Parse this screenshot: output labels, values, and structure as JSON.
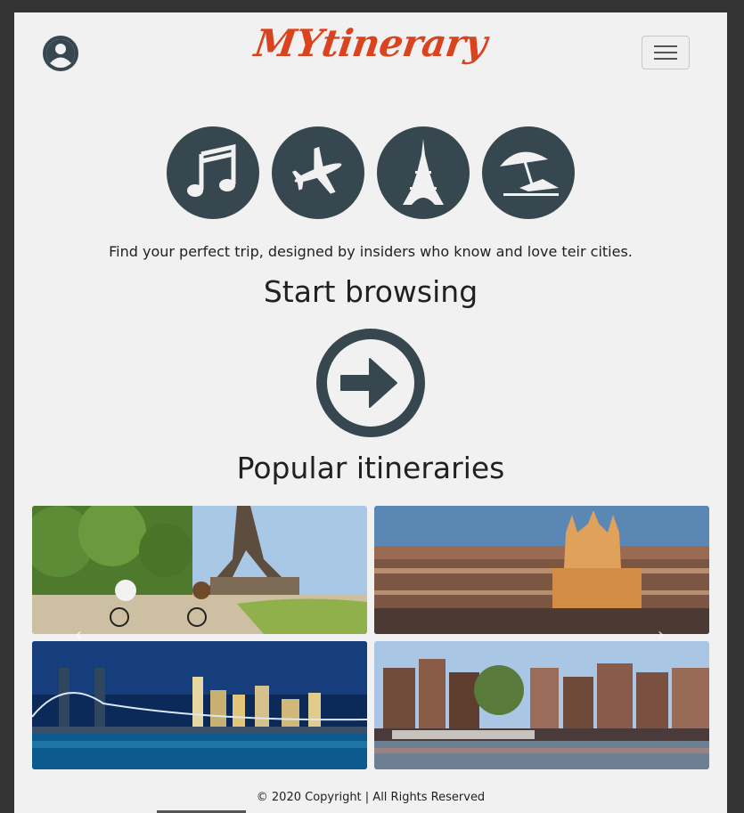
{
  "header": {
    "logo_text": "MYtinerary",
    "user_icon": "user-circle-icon",
    "menu_icon": "hamburger-icon"
  },
  "hero": {
    "icons": [
      "music-note-icon",
      "airplane-icon",
      "eiffel-tower-icon",
      "beach-umbrella-icon"
    ],
    "tagline": "Find your perfect trip, designed by insiders who know and love teir cities.",
    "cta_heading": "Start browsing",
    "cta_icon": "arrow-right-circle-icon"
  },
  "popular": {
    "heading": "Popular itineraries",
    "cards": [
      {
        "image": "paris-eiffel-bikes"
      },
      {
        "image": "barcelona-sagrada-familia"
      },
      {
        "image": "new-york-brooklyn-bridge"
      },
      {
        "image": "amsterdam-canal-houses"
      }
    ],
    "prev_icon": "chevron-left-icon",
    "next_icon": "chevron-right-icon"
  },
  "footer": {
    "copyright": "© 2020 Copyright | All Rights Reserved"
  },
  "colors": {
    "accent": "#d9431e",
    "icon_dark": "#37474f",
    "background": "#f1f1f1",
    "frame": "#333333"
  }
}
